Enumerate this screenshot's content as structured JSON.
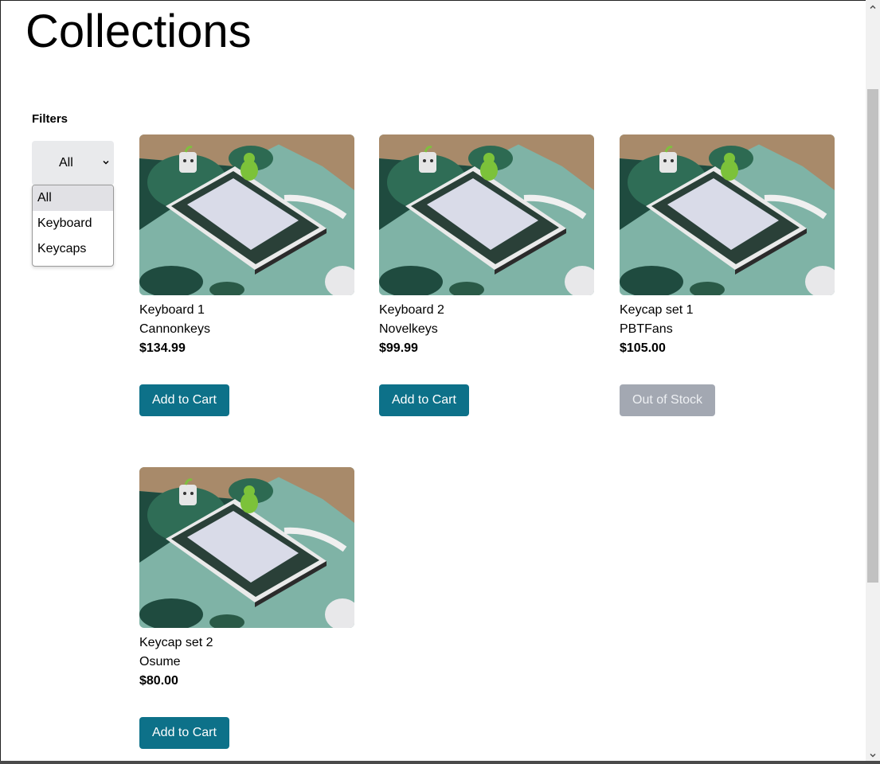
{
  "page": {
    "title": "Collections"
  },
  "filters": {
    "label": "Filters",
    "selected": "All",
    "options": [
      "All",
      "Keyboard",
      "Keycaps"
    ]
  },
  "products": [
    {
      "name": "Keyboard 1",
      "brand": "Cannonkeys",
      "price": "$134.99",
      "button": "Add to Cart",
      "in_stock": true
    },
    {
      "name": "Keyboard 2",
      "brand": "Novelkeys",
      "price": "$99.99",
      "button": "Add to Cart",
      "in_stock": true
    },
    {
      "name": "Keycap set 1",
      "brand": "PBTFans",
      "price": "$105.00",
      "button": "Out of Stock",
      "in_stock": false
    },
    {
      "name": "Keycap set 2",
      "brand": "Osume",
      "price": "$80.00",
      "button": "Add to Cart",
      "in_stock": true
    }
  ],
  "colors": {
    "primary_button": "#0d7189",
    "disabled_button": "#a3a8b2",
    "select_background": "#e9eaec"
  },
  "icons": {
    "select": "chevron-down-icon",
    "scroll_up": "triangle-up-icon",
    "scroll_down": "triangle-down-icon"
  }
}
